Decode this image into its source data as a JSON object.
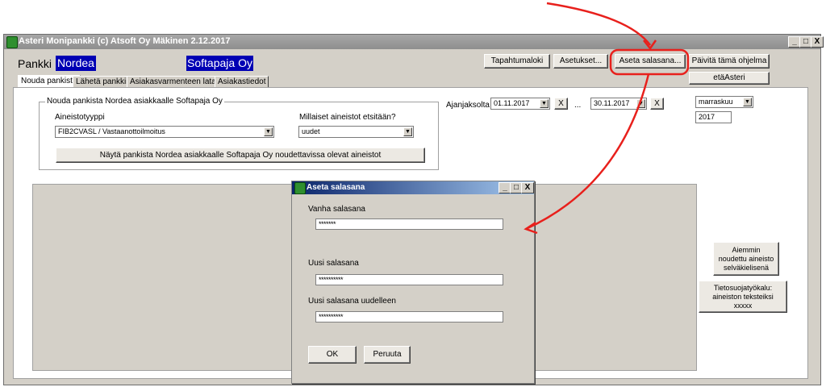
{
  "window": {
    "title": "Asteri Monipankki  (c) Atsoft Oy Mäkinen 2.12.2017",
    "min": "_",
    "max": "□",
    "close": "X"
  },
  "header": {
    "bank_label": "Pankki",
    "bank_name": "Nordea",
    "customer_name": "Softapaja Oy"
  },
  "toolbar": {
    "events": "Tapahtumaloki",
    "settings": "Asetukset...",
    "set_password": "Aseta salasana...",
    "update": "Päivitä tämä ohjelma",
    "eta": "etäAsteri"
  },
  "tabs": [
    {
      "label": "Nouda pankista"
    },
    {
      "label": "Lähetä pankkiin"
    },
    {
      "label": "Asiakasvarmenteen lataus"
    },
    {
      "label": "Asiakastiedot"
    }
  ],
  "fetch": {
    "group_title": "Nouda pankista Nordea asiakkaalle Softapaja Oy",
    "type_label": "Aineistotyyppi",
    "type_value": "FIB2CVASL / Vastaanottoilmoitus",
    "which_label": "Millaiset aineistot etsitään?",
    "which_value": "uudet",
    "show_button": "Näytä pankista Nordea asiakkaalle Softapaja Oy noudettavissa olevat aineistot"
  },
  "period": {
    "label": "Ajanjaksolta",
    "from": "01.11.2017",
    "to": "30.11.2017",
    "sep": "...",
    "clear": "X",
    "month": "marraskuu",
    "year": "2017"
  },
  "side_buttons": {
    "plain_line1": "Aiemmin",
    "plain_line2": "noudettu aineisto",
    "plain_line3": "selväkielisenä",
    "privacy_line1": "Tietosuojatyökalu:",
    "privacy_line2": "aineiston teksteiksi",
    "privacy_line3": "xxxxx"
  },
  "dialog": {
    "title": "Aseta salasana",
    "old_label": "Vanha salasana",
    "old_value": "*******",
    "new_label": "Uusi salasana",
    "new_value": "**********",
    "repeat_label": "Uusi salasana uudelleen",
    "repeat_value": "**********",
    "ok": "OK",
    "cancel": "Peruuta"
  },
  "colors": {
    "annotation": "#e8201c",
    "bank_bg": "#0000b4"
  }
}
